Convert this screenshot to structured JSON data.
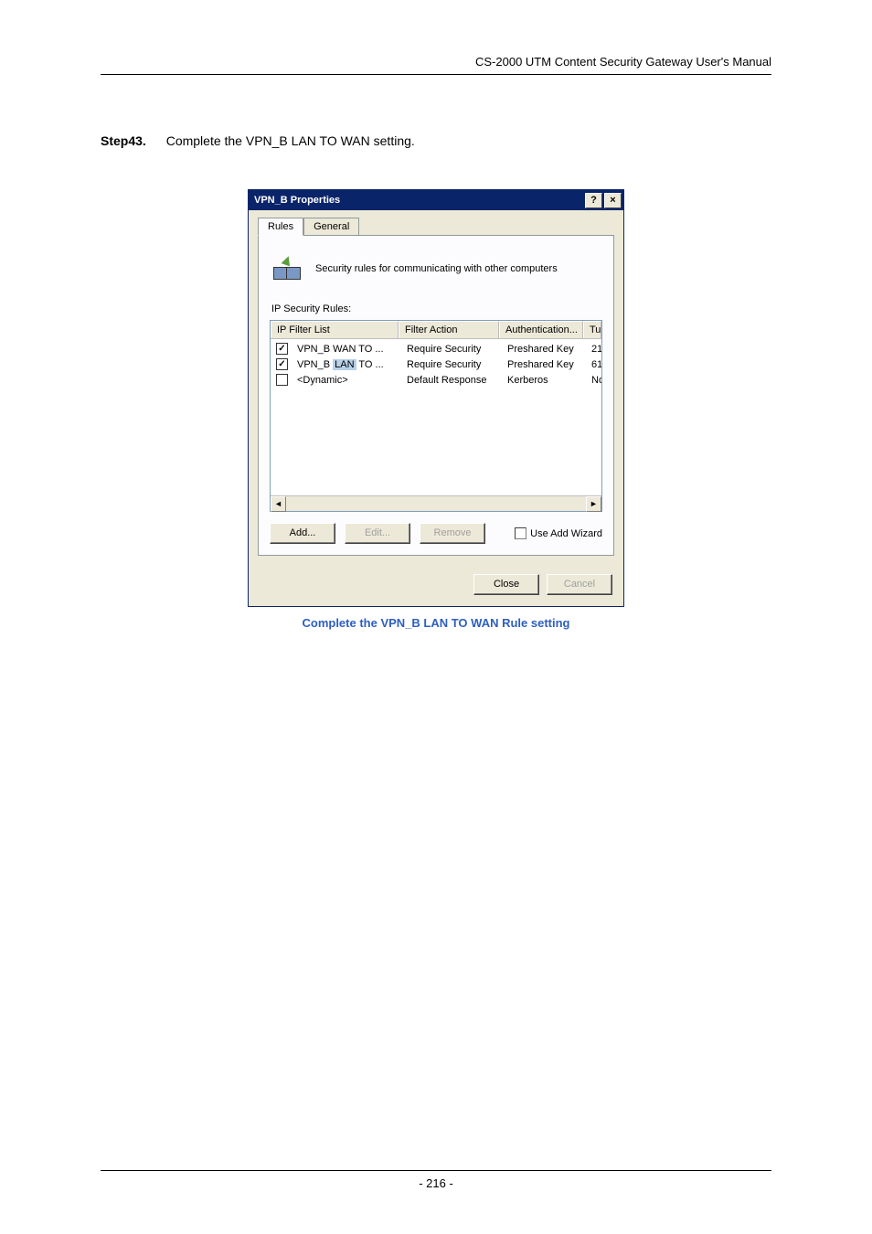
{
  "header": {
    "text": "CS-2000 UTM Content Security Gateway User's Manual"
  },
  "step": {
    "label": "Step43.",
    "text": "Complete the VPN_B LAN TO WAN setting."
  },
  "dialog": {
    "title": "VPN_B Properties",
    "help_btn": "?",
    "close_btn": "×",
    "tabs": {
      "rules": "Rules",
      "general": "General"
    },
    "description": "Security rules for communicating with other computers",
    "section_label": "IP Security Rules:",
    "columns": {
      "c1": "IP Filter List",
      "c2": "Filter Action",
      "c3": "Authentication...",
      "c4": "Tu"
    },
    "rows": [
      {
        "checked": true,
        "name_pre": "VPN_B WAN TO ...",
        "highlight": "",
        "action": "Require Security",
        "auth": "Preshared Key",
        "tu": "21"
      },
      {
        "checked": true,
        "name_pre": "VPN_B ",
        "highlight": "LAN",
        "name_post": " TO ...",
        "action": "Require Security",
        "auth": "Preshared Key",
        "tu": "61"
      },
      {
        "checked": false,
        "name_pre": "<Dynamic>",
        "highlight": "",
        "action": "Default Response",
        "auth": "Kerberos",
        "tu": "No"
      }
    ],
    "buttons": {
      "add": "Add...",
      "edit": "Edit...",
      "remove": "Remove"
    },
    "use_add_wizard": "Use Add Wizard",
    "close": "Close",
    "cancel": "Cancel"
  },
  "caption": "Complete the VPN_B LAN TO WAN Rule setting",
  "footer": {
    "page": "- 216 -"
  }
}
